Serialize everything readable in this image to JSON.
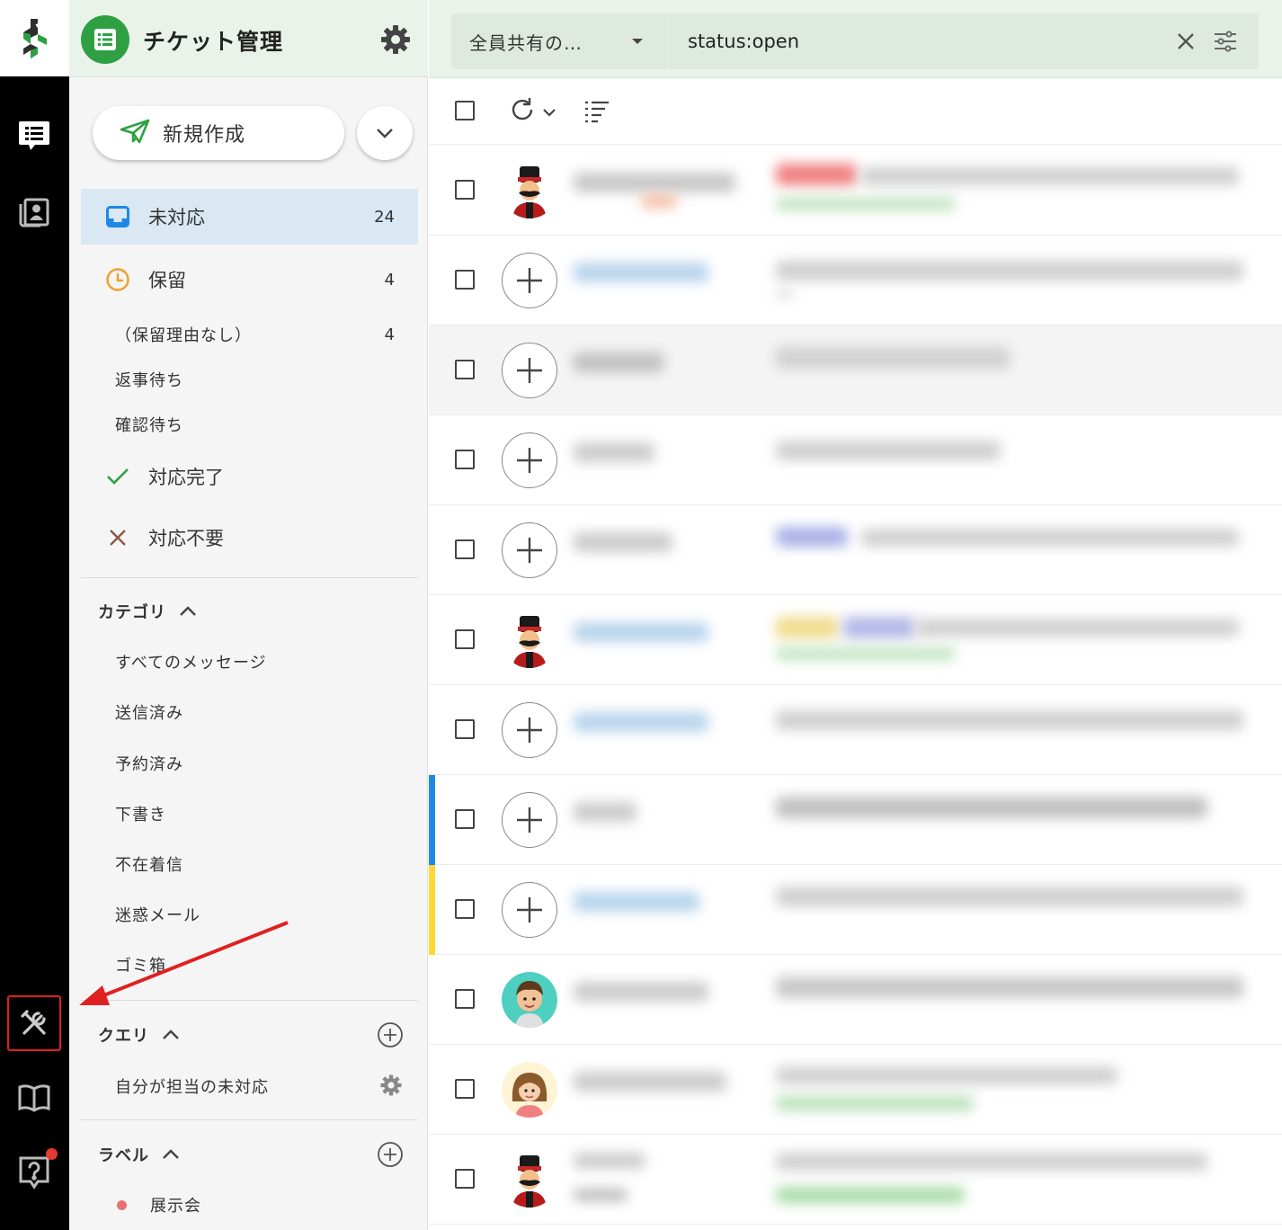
{
  "rail": {
    "icons": [
      "brand-logo-icon",
      "ticket-icon",
      "contacts-icon",
      "tools-icon",
      "manual-book-icon",
      "help-icon"
    ]
  },
  "sidebar": {
    "title": "チケット管理",
    "new_button_label": "新規作成",
    "status_items": [
      {
        "label": "未対応",
        "count": "24"
      },
      {
        "label": "保留",
        "count": "4"
      },
      {
        "label": "（保留理由なし）",
        "count": "4"
      },
      {
        "label": "返事待ち",
        "count": ""
      },
      {
        "label": "確認待ち",
        "count": ""
      },
      {
        "label": "対応完了",
        "count": ""
      },
      {
        "label": "対応不要",
        "count": ""
      }
    ],
    "category_title": "カテゴリ",
    "categories": [
      "すべてのメッセージ",
      "送信済み",
      "予約済み",
      "下書き",
      "不在着信",
      "迷惑メール",
      "ゴミ箱"
    ],
    "query_title": "クエリ",
    "queries": [
      "自分が担当の未対応"
    ],
    "label_title": "ラベル",
    "labels": [
      "展示会"
    ]
  },
  "main": {
    "view_select": "全員共有の…",
    "search_value": "status:open"
  },
  "colors": {
    "accent_green": "#2ea043",
    "active_bg": "#d9e8f2",
    "header_bg": "#eaf3e9",
    "bar_blue": "#1e88e5",
    "bar_yellow": "#fdd835",
    "highlight_red": "#e02020"
  }
}
